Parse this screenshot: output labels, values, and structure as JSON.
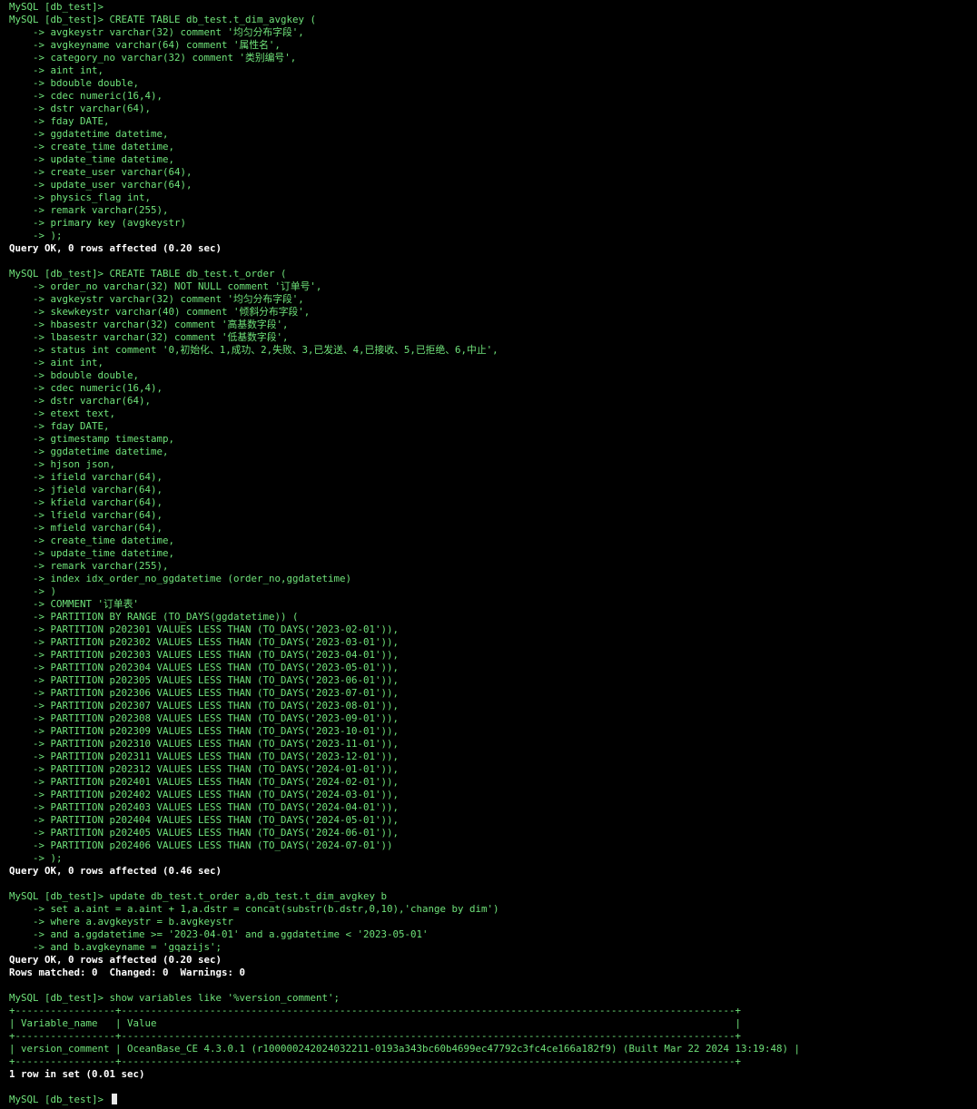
{
  "prompt": "MySQL [db_test]> ",
  "cont": "    -> ",
  "colors": {
    "background": "#000000",
    "text": "#6fe37a",
    "bold_text": "#ffffff"
  },
  "block1": {
    "empty_prompt": "MySQL [db_test]>",
    "create_head": "CREATE TABLE db_test.t_dim_avgkey (",
    "lines": [
      "avgkeystr varchar(32) comment '均匀分布字段',",
      "avgkeyname varchar(64) comment '属性名',",
      "category_no varchar(32) comment '类别编号',",
      "aint int,",
      "bdouble double,",
      "cdec numeric(16,4),",
      "dstr varchar(64),",
      "fday DATE,",
      "ggdatetime datetime,",
      "create_time datetime,",
      "update_time datetime,",
      "create_user varchar(64),",
      "update_user varchar(64),",
      "physics_flag int,",
      "remark varchar(255),",
      "primary key (avgkeystr)",
      ");"
    ],
    "result": "Query OK, 0 rows affected (0.20 sec)"
  },
  "block2": {
    "create_head": "CREATE TABLE db_test.t_order (",
    "lines": [
      "order_no varchar(32) NOT NULL comment '订单号',",
      "avgkeystr varchar(32) comment '均匀分布字段',",
      "skewkeystr varchar(40) comment '倾斜分布字段',",
      "hbasestr varchar(32) comment '高基数字段',",
      "lbasestr varchar(32) comment '低基数字段',",
      "status int comment '0,初始化、1,成功、2,失败、3,已发送、4,已接收、5,已拒绝、6,中止',",
      "aint int,",
      "bdouble double,",
      "cdec numeric(16,4),",
      "dstr varchar(64),",
      "etext text,",
      "fday DATE,",
      "gtimestamp timestamp,",
      "ggdatetime datetime,",
      "hjson json,",
      "ifield varchar(64),",
      "jfield varchar(64),",
      "kfield varchar(64),",
      "lfield varchar(64),",
      "mfield varchar(64),",
      "create_time datetime,",
      "update_time datetime,",
      "remark varchar(255),",
      "index idx_order_no_ggdatetime (order_no,ggdatetime)",
      ")",
      "COMMENT '订单表'",
      "PARTITION BY RANGE (TO_DAYS(ggdatetime)) (",
      "PARTITION p202301 VALUES LESS THAN (TO_DAYS('2023-02-01')),",
      "PARTITION p202302 VALUES LESS THAN (TO_DAYS('2023-03-01')),",
      "PARTITION p202303 VALUES LESS THAN (TO_DAYS('2023-04-01')),",
      "PARTITION p202304 VALUES LESS THAN (TO_DAYS('2023-05-01')),",
      "PARTITION p202305 VALUES LESS THAN (TO_DAYS('2023-06-01')),",
      "PARTITION p202306 VALUES LESS THAN (TO_DAYS('2023-07-01')),",
      "PARTITION p202307 VALUES LESS THAN (TO_DAYS('2023-08-01')),",
      "PARTITION p202308 VALUES LESS THAN (TO_DAYS('2023-09-01')),",
      "PARTITION p202309 VALUES LESS THAN (TO_DAYS('2023-10-01')),",
      "PARTITION p202310 VALUES LESS THAN (TO_DAYS('2023-11-01')),",
      "PARTITION p202311 VALUES LESS THAN (TO_DAYS('2023-12-01')),",
      "PARTITION p202312 VALUES LESS THAN (TO_DAYS('2024-01-01')),",
      "PARTITION p202401 VALUES LESS THAN (TO_DAYS('2024-02-01')),",
      "PARTITION p202402 VALUES LESS THAN (TO_DAYS('2024-03-01')),",
      "PARTITION p202403 VALUES LESS THAN (TO_DAYS('2024-04-01')),",
      "PARTITION p202404 VALUES LESS THAN (TO_DAYS('2024-05-01')),",
      "PARTITION p202405 VALUES LESS THAN (TO_DAYS('2024-06-01')),",
      "PARTITION p202406 VALUES LESS THAN (TO_DAYS('2024-07-01'))",
      ");"
    ],
    "result": "Query OK, 0 rows affected (0.46 sec)"
  },
  "block3": {
    "head": "update db_test.t_order a,db_test.t_dim_avgkey b",
    "lines": [
      "set a.aint = a.aint + 1,a.dstr = concat(substr(b.dstr,0,10),'change by dim')",
      "where a.avgkeystr = b.avgkeystr",
      "and a.ggdatetime >= '2023-04-01' and a.ggdatetime < '2023-05-01'",
      "and b.avgkeyname = 'gqazijs';"
    ],
    "result": "Query OK, 0 rows affected (0.20 sec)",
    "result2": "Rows matched: 0  Changed: 0  Warnings: 0"
  },
  "block4": {
    "command": "show variables like '%version_comment';",
    "table_lines": [
      "+-----------------+--------------------------------------------------------------------------------------------------------+",
      "| Variable_name   | Value                                                                                                  |",
      "+-----------------+--------------------------------------------------------------------------------------------------------+",
      "| version_comment | OceanBase_CE 4.3.0.1 (r100000242024032211-0193a343bc60b4699ec47792c3fc4ce166a182f9) (Built Mar 22 2024 13:19:48) |",
      "+-----------------+--------------------------------------------------------------------------------------------------------+"
    ],
    "result": "1 row in set (0.01 sec)"
  },
  "final_prompt": "MySQL [db_test]>"
}
